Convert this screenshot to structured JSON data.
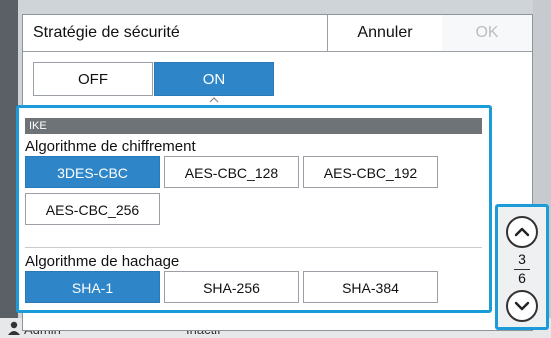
{
  "dialog": {
    "title": "Stratégie de sécurité",
    "cancel_label": "Annuler",
    "ok_label": "OK"
  },
  "toggle": {
    "off_label": "OFF",
    "on_label": "ON",
    "selected": "ON"
  },
  "panel": {
    "section_header": "IKE",
    "encryption": {
      "label": "Algorithme de chiffrement",
      "options": [
        "3DES-CBC",
        "AES-CBC_128",
        "AES-CBC_192",
        "AES-CBC_256"
      ],
      "selected": "3DES-CBC"
    },
    "hash": {
      "label": "Algorithme de hachage",
      "options": [
        "SHA-1",
        "SHA-256",
        "SHA-384"
      ],
      "selected": "SHA-1"
    }
  },
  "pager": {
    "current": "3",
    "total": "6"
  },
  "background": {
    "user": "Admin",
    "status": "Inactif"
  },
  "colors": {
    "accent": "#2e86c9",
    "focus_border": "#1b9bd7",
    "section_header": "#6e7378"
  },
  "icons": {
    "up": "chevron-up-icon",
    "down": "chevron-down-icon",
    "user": "user-icon"
  }
}
